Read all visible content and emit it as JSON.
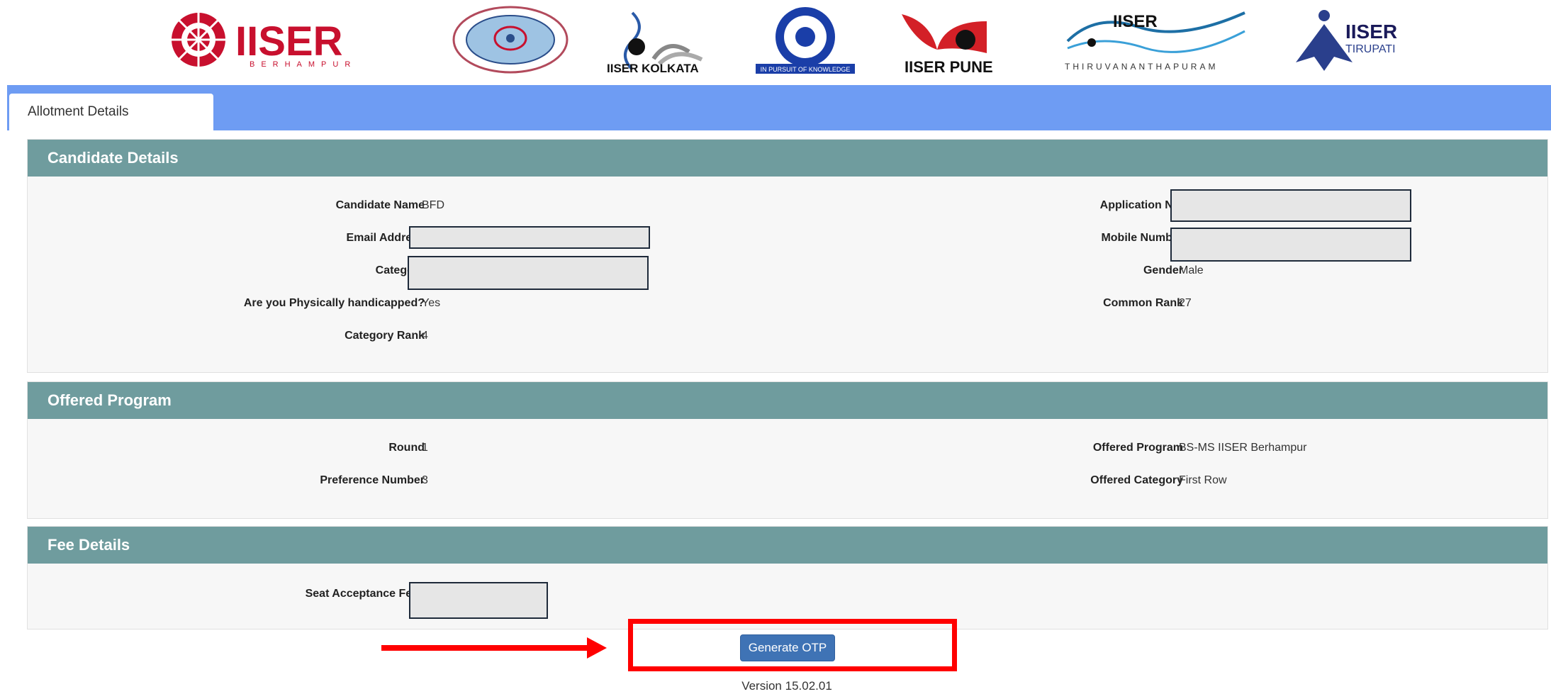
{
  "logos": [
    {
      "name": "iiser-berhampur-logo",
      "text": "IISER",
      "sub": "BERHAMPUR"
    },
    {
      "name": "iiser-bhopal-logo",
      "text": "",
      "sub": ""
    },
    {
      "name": "iiser-kolkata-logo",
      "text": "IISER KOLKATA",
      "sub": ""
    },
    {
      "name": "iiser-mohali-logo",
      "text": "IN PURSUIT OF KNOWLEDGE",
      "sub": ""
    },
    {
      "name": "iiser-pune-logo",
      "text": "IISER PUNE",
      "sub": ""
    },
    {
      "name": "iiser-tvm-logo",
      "text": "IISER",
      "sub": "THIRUVANANTHAPURAM"
    },
    {
      "name": "iiser-tirupati-logo",
      "text": "IISER",
      "sub": "TIRUPATI"
    }
  ],
  "tabs": {
    "allotment_details": "Allotment Details"
  },
  "candidate": {
    "title": "Candidate Details",
    "name_label": "Candidate Name",
    "name_value": "BFD",
    "email_label": "Email Address",
    "category_label": "Category",
    "ph_label": "Are you Physically handicapped?",
    "ph_value": "Yes",
    "category_rank_label": "Category Rank",
    "category_rank_value": "4",
    "application_label": "Application No.",
    "mobile_label": "Mobile Number",
    "gender_label": "Gender",
    "gender_value": "Male",
    "common_rank_label": "Common Rank",
    "common_rank_value": "27"
  },
  "offered": {
    "title": "Offered Program",
    "round_label": "Round",
    "round_value": "1",
    "pref_label": "Preference Number",
    "pref_value": "3",
    "program_label": "Offered Program",
    "program_value": "BS-MS IISER Berhampur",
    "category_label": "Offered Category",
    "category_value": "First Row"
  },
  "fee": {
    "title": "Fee Details",
    "seat_fee_label": "Seat Acceptance Fees"
  },
  "actions": {
    "generate_otp": "Generate OTP"
  },
  "footer": {
    "version": "Version 15.02.01"
  },
  "colors": {
    "tabbar": "#6e9cf3",
    "panel_head": "#6f9c9e",
    "button": "#3f73b5",
    "highlight": "#ff0000"
  }
}
